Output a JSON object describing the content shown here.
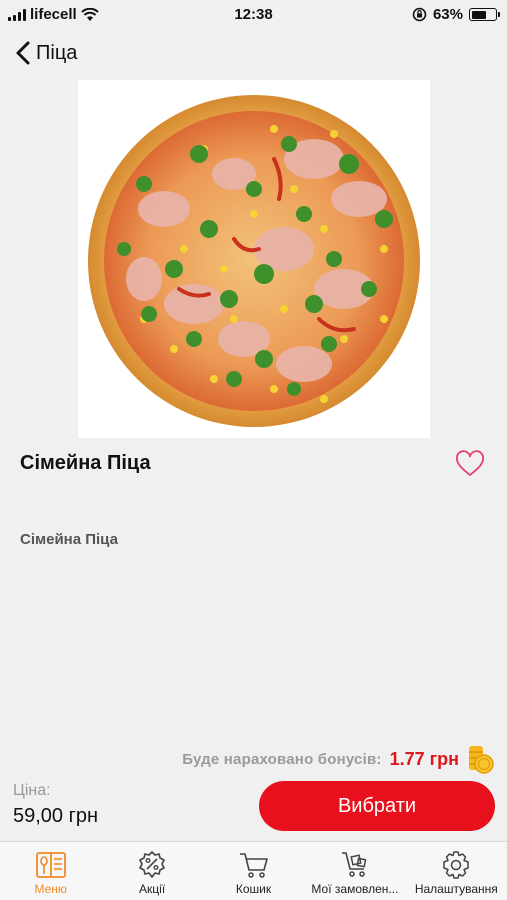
{
  "status_bar": {
    "carrier": "lifecell",
    "time": "12:38",
    "battery_percent": "63%",
    "battery_level": 0.63
  },
  "nav": {
    "back_icon": "chevron-left-icon",
    "title": "Піца"
  },
  "product": {
    "image": "pizza-photo",
    "title": "Сімейна Піца",
    "description": "Сімейна Піца",
    "favorite_icon": "heart-outline-icon"
  },
  "bonus": {
    "label": "Буде нараховано бонусів:",
    "value": "1.77 грн",
    "icon": "coins-icon"
  },
  "price": {
    "label": "Ціна:",
    "value": "59,00 грн"
  },
  "actions": {
    "choose_label": "Вибрати"
  },
  "colors": {
    "accent_red": "#e8101c",
    "bonus_red": "#e0161e",
    "tab_active": "#f08a24"
  },
  "tabbar": {
    "tabs": [
      {
        "label": "Меню",
        "icon": "menu-book-icon",
        "active": true
      },
      {
        "label": "Акції",
        "icon": "percent-badge-icon",
        "active": false
      },
      {
        "label": "Кошик",
        "icon": "cart-icon",
        "active": false
      },
      {
        "label": "Мої замовлен...",
        "icon": "orders-cart-icon",
        "active": false
      },
      {
        "label": "Налаштування",
        "icon": "gear-icon",
        "active": false
      }
    ]
  }
}
